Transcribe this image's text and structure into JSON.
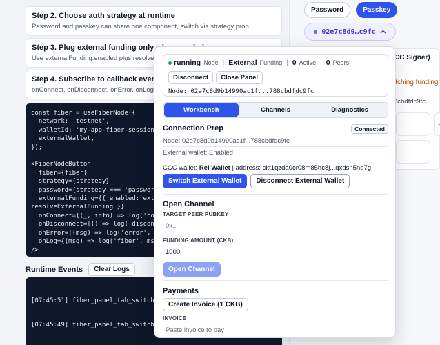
{
  "steps": [
    {
      "title": "Step 2. Choose auth strategy at runtime",
      "desc": "Password and passkey can share one component, switch via strategy prop."
    },
    {
      "title": "Step 3. Plug external funding only when needed",
      "desc": "Use externalFunding.enabled plus resolve callbacks"
    },
    {
      "title": "Step 4. Subscribe to callback events",
      "desc": "onConnect, onDisconnect, onError, onLog callbacks"
    }
  ],
  "code": "const fiber = useFiberNode({\n  network: 'testnet',\n  walletId: 'my-app-fiber-session',\n  externalWallet,\n});\n\n<FiberNodeButton\n  fiber={fiber}\n  strategy={strategy}\n  password={strategy === 'password' ?\n  externalFunding={{ enabled: exter\nresolveExternalFunding }}\n  onConnect={(_, info) => log('conn\n  onDisconnect={() => log('disconne\n  onError={(msg) => log('error', ms\n  onLog={(msg) => log('fiber', msg)\n/>",
  "events": {
    "title": "Runtime Events",
    "clear_label": "Clear Logs",
    "lines": [
      "[07:45:51] fiber_panel_tab_switched:",
      "[07:45:49] fiber_panel_tab_switched:"
    ]
  },
  "auth": {
    "options": [
      {
        "label": "Password",
        "active": false
      },
      {
        "label": "Passkey",
        "active": true
      }
    ],
    "node_pill": "02e7c8d9…c9fc",
    "chevron": "^"
  },
  "background_panel": {
    "title": "CC Signer)",
    "status": "itching funding",
    "node": "8cbdfdc9fc",
    "chevron": "⌄"
  },
  "popover": {
    "status": {
      "state": "running",
      "state_label": "Node",
      "funding": "External",
      "funding_label": "Funding",
      "active_count": "0",
      "active_label": "Active",
      "peers_count": "0",
      "peers_label": "Peers",
      "disconnect_label": "Disconnect",
      "close_label": "Close Panel",
      "node_line": "Node: 02e7c8d9b14990ac1f...788cbdfdc9fc"
    },
    "tabs": [
      {
        "label": "Workbench",
        "active": true
      },
      {
        "label": "Channels",
        "active": false
      },
      {
        "label": "Diagnostics",
        "active": false
      }
    ],
    "prep": {
      "title": "Connection Prep",
      "badge": "Connected",
      "node": "Node: 02e7c8d9b14990ac1f...788cbdfdc9fc",
      "external": "External wallet: Enabled",
      "wallet_prefix": "CCC wallet:",
      "wallet_name": "Rei Wallet",
      "address": "| address: ckt1qzda0cr08m85hc8j...qxdsn5nd7g",
      "switch_label": "Switch External Wallet",
      "disconnect_label": "Disconnect External Wallet"
    },
    "open_channel": {
      "title": "Open Channel",
      "peer_label": "TARGET PEER PUBKEY",
      "peer_placeholder": "0x...",
      "amount_label": "FUNDING AMOUNT (CKB)",
      "amount_value": "1000",
      "button_label": "Open Channel"
    },
    "payments": {
      "title": "Payments",
      "create_label": "Create Invoice (1 CKB)",
      "invoice_label": "INVOICE",
      "invoice_placeholder": "Paste invoice to pay"
    }
  },
  "colors": {
    "accent": "#2f54eb",
    "code_bg": "#0f172a",
    "success": "#16a34a"
  }
}
